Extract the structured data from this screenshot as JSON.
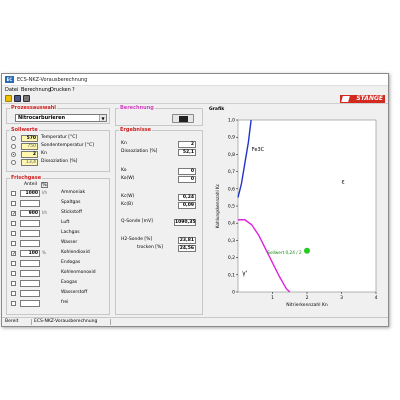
{
  "window": {
    "title": "ECS-NKZ-Vorausberechnung",
    "icon_text": "EC"
  },
  "menu": [
    "Datei",
    "Berechnung",
    "Drucken",
    "?"
  ],
  "logo": "STANGE",
  "prozessauswahl": {
    "title": "Prozessauswahl",
    "selected": "Nitrocarburieren"
  },
  "sollwerte": {
    "title": "Sollwerte",
    "rows": [
      {
        "value": "570",
        "label": "Temperatur [°C]"
      },
      {
        "value": "750",
        "label": "Sondentemperatur [°C]"
      },
      {
        "value": "2",
        "label": "Kn"
      },
      {
        "value": "13,4",
        "label": "Dissoziation [%]"
      }
    ]
  },
  "frischgase": {
    "title": "Frischgase",
    "header_anteil": "Anteil",
    "header_pct": "%",
    "rows": [
      {
        "value": "1000",
        "unit": "I/h",
        "label": "Ammoniak",
        "checked": false
      },
      {
        "value": "",
        "unit": "",
        "label": "Spaltgas",
        "checked": false
      },
      {
        "value": "900",
        "unit": "I/h",
        "label": "Stickstoff",
        "checked": true
      },
      {
        "value": "",
        "unit": "",
        "label": "Luft",
        "checked": false
      },
      {
        "value": "",
        "unit": "",
        "label": "Lachgas",
        "checked": false
      },
      {
        "value": "",
        "unit": "",
        "label": "Wasser",
        "checked": false
      },
      {
        "value": "100",
        "unit": "%",
        "label": "Kohlendioxid",
        "checked": true
      },
      {
        "value": "",
        "unit": "",
        "label": "Endogas",
        "checked": false
      },
      {
        "value": "",
        "unit": "",
        "label": "Kohlenmonoxid",
        "checked": false
      },
      {
        "value": "",
        "unit": "",
        "label": "Exogas",
        "checked": false
      },
      {
        "value": "",
        "unit": "",
        "label": "Wasserstoff",
        "checked": false
      },
      {
        "value": "",
        "unit": "",
        "label": "frei",
        "checked": false
      }
    ]
  },
  "berechnung": {
    "title": "Berechnung"
  },
  "ergebnisse": {
    "title": "Ergebnisse",
    "kn": {
      "label": "Kn",
      "value": "2"
    },
    "dissoziation": {
      "label": "Dissoziation [%]",
      "value": "52,1"
    },
    "ko": {
      "label": "Ko",
      "value": "0"
    },
    "ko_w": {
      "label": "Ko(W)",
      "value": "0"
    },
    "kc_w": {
      "label": "Kc(W)",
      "value": "0,24"
    },
    "kc_b": {
      "label": "Kc(B)",
      "value": "0,09"
    },
    "q_sonde": {
      "label": "Q-Sonde [mV]",
      "value": "1090,35"
    },
    "h2_sonde": {
      "label": "H2-Sonde [%]",
      "value": "23,81"
    },
    "trocken": {
      "label": "trocken [%]",
      "value": "24,56"
    }
  },
  "grafik": {
    "title": "Grafik",
    "ylabel": "Kohlungskennzahl Kc",
    "xlabel": "Nitrierkennzahl Kn",
    "phase_fe3c": "Fe3C",
    "phase_eps": "ε",
    "phase_gamma": "γ'",
    "sollwert_label": "Sollwert 0,24 / 2",
    "colors": {
      "fe3c_line": "#2233cc",
      "gamma_line": "#dd22dd",
      "point": "#22cc22"
    }
  },
  "chart_data": {
    "type": "line",
    "xlabel": "Nitrierkennzahl Kn",
    "ylabel": "Kohlungskennzahl Kc",
    "xlim": [
      0,
      4
    ],
    "ylim": [
      0,
      1.0
    ],
    "x_ticks": [
      "1",
      "2",
      "3",
      "4"
    ],
    "y_ticks": [
      "0",
      "0,1",
      "0,2",
      "0,3",
      "0,4",
      "0,5",
      "0,6",
      "0,7",
      "0,8",
      "0,9",
      "1,0"
    ],
    "series": [
      {
        "x": [
          0,
          0.1,
          0.2,
          0.3,
          0.38
        ],
        "y": [
          0.55,
          0.63,
          0.75,
          0.87,
          1.0
        ]
      },
      {
        "x": [
          0,
          0.2,
          0.4,
          0.6,
          0.8,
          1.0,
          1.2,
          1.4,
          1.5
        ],
        "y": [
          0.42,
          0.42,
          0.39,
          0.33,
          0.25,
          0.17,
          0.09,
          0.02,
          0
        ]
      }
    ],
    "points": [
      {
        "x": 2,
        "y": 0.24
      }
    ]
  },
  "status": {
    "left": "Bereit",
    "right": "ECS-NKZ-Vorausberechnung"
  }
}
